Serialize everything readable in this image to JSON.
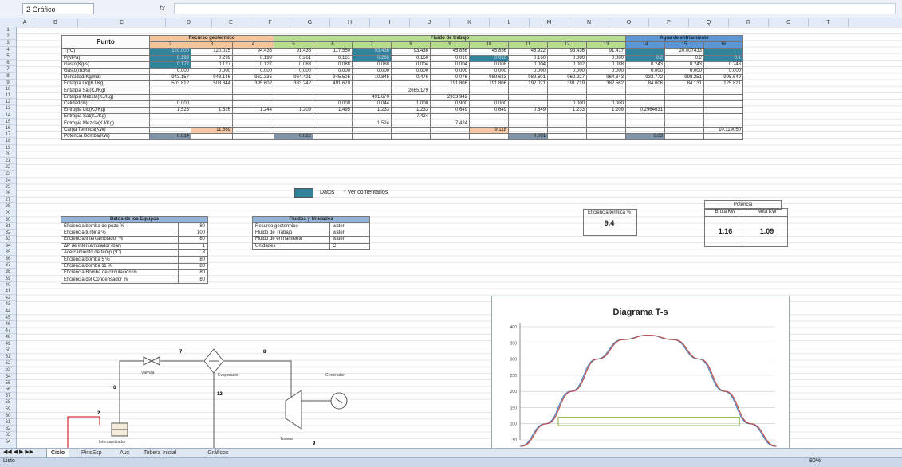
{
  "formula_bar": {
    "name_box": "2 Gráfico",
    "fx": "fx",
    "formula": ""
  },
  "columns": [
    "A",
    "B",
    "C",
    "D",
    "E",
    "F",
    "G",
    "H",
    "I",
    "J",
    "K",
    "L",
    "M",
    "N",
    "O",
    "P",
    "Q",
    "R",
    "S",
    "T"
  ],
  "rows": [
    "1",
    "2",
    "3",
    "4",
    "5",
    "6",
    "7",
    "8",
    "9",
    "10",
    "11",
    "12",
    "13",
    "14",
    "15",
    "16",
    "17",
    "18",
    "19",
    "20",
    "21",
    "22",
    "23",
    "24",
    "25",
    "26",
    "27",
    "28",
    "29",
    "30",
    "31",
    "32",
    "33",
    "34",
    "35",
    "36",
    "37",
    "38",
    "39",
    "40",
    "41",
    "42",
    "43",
    "44",
    "45",
    "46",
    "47",
    "48",
    "49",
    "50",
    "51",
    "52",
    "53",
    "54",
    "55",
    "56",
    "57",
    "58",
    "59",
    "60",
    "61",
    "62",
    "63",
    "64"
  ],
  "main_table": {
    "punto": "Punto",
    "group_headers": {
      "recurso": "Recurso geotermico",
      "fluido": "Fluido de trabajo",
      "agua": "Agua de enfriamiento"
    },
    "points": [
      "2",
      "3",
      "4",
      "5",
      "6",
      "7",
      "8",
      "9",
      "10",
      "11",
      "12",
      "13",
      "14",
      "15",
      "16"
    ],
    "rows": [
      {
        "label": "T(ºC)",
        "cells": [
          "120.000",
          "120.015",
          "94.436",
          "91.436",
          "117.550",
          "93.436",
          "93.436",
          "45.856",
          "45.856",
          "45.922",
          "93.436",
          "91.417",
          "",
          "20.007433",
          ""
        ]
      },
      {
        "label": "P(MPa)",
        "cells": [
          "0.199",
          "0.299",
          "0.199",
          "0.261",
          "0.161",
          "0.286",
          "0.160",
          "0.010",
          "0.010",
          "0.160",
          "0.080",
          "0.080",
          "0.2",
          "0.2",
          "0.1"
        ]
      },
      {
        "label": "Gasto(Kg/s)",
        "cells": [
          "0.177",
          "0.127",
          "0.127",
          "0.088",
          "0.088",
          "0.088",
          "0.004",
          "0.004",
          "0.008",
          "0.004",
          "0.002",
          "0.088",
          "0.243",
          "0.243",
          "0.243"
        ]
      },
      {
        "label": "Gasto(m3/s)",
        "cells": [
          "0.000",
          "0.000",
          "0.000",
          "0.000",
          "0.000",
          "0.000",
          "0.000",
          "0.000",
          "0.000",
          "0.000",
          "0.000",
          "0.000",
          "0.000",
          "0.000",
          "0.000"
        ]
      },
      {
        "label": "Densidad(Kg/m3)",
        "cells": [
          "943.157",
          "943.146",
          "962.335",
          "964.421",
          "945.505",
          "10.845",
          "0.476",
          "0.076",
          "989.623",
          "989.601",
          "962.927",
          "964.343",
          "933.772",
          "998.251",
          "995.649"
        ]
      },
      {
        "label": "Entalpia Liq(KJ/Kg)",
        "cells": [
          "503.812",
          "503.844",
          "395.602",
          "383.242",
          "491.670",
          "",
          "",
          "191.806",
          "191.806",
          "192.021",
          "391.719",
          "382.562",
          "84.006",
          "84.131",
          "125.821"
        ]
      },
      {
        "label": "Entalpia Sat(KJ/Kg)",
        "cells": [
          "",
          "",
          "",
          "",
          "",
          "",
          "2665.179",
          "",
          "",
          "",
          "",
          "",
          "",
          "",
          ""
        ]
      },
      {
        "label": "Entalpia Mezcla(KJ/Kg)",
        "cells": [
          "",
          "",
          "",
          "",
          "",
          "491.670",
          "",
          "2333.942",
          "",
          "",
          "",
          "",
          "",
          "",
          ""
        ]
      },
      {
        "label": "Calidad(%)",
        "cells": [
          "0.000",
          "",
          "",
          "",
          "0.000",
          "0.044",
          "1.000",
          "0.900",
          "0.000",
          "",
          "0.000",
          "0.000",
          "",
          "",
          ""
        ]
      },
      {
        "label": "Entropia Liq(KJ/Kg)",
        "cells": [
          "1.526",
          "1.526",
          "1.244",
          "1.209",
          "1.495",
          "1.233",
          "1.233",
          "0.649",
          "0.649",
          "0.649",
          "1.233",
          "1.209",
          "0.2964631",
          "",
          ""
        ]
      },
      {
        "label": "Entropia Sat(KJ/Kg)",
        "cells": [
          "",
          "",
          "",
          "",
          "",
          "",
          "7.424",
          "",
          "",
          "",
          "",
          "",
          "",
          "",
          ""
        ]
      },
      {
        "label": "Entropia Mezcla(KJ/Kg)",
        "cells": [
          "",
          "",
          "",
          "",
          "",
          "1.524",
          "",
          "7.424",
          "",
          "",
          "",
          "",
          "",
          "",
          ""
        ]
      },
      {
        "label": "Carga Termica(KW)",
        "cells": [
          "",
          "11.569",
          "",
          "",
          "",
          "",
          "",
          "",
          "9.118",
          "",
          "",
          "",
          "",
          "",
          "10.119050"
        ]
      },
      {
        "label": "Potencia Bomba(KW)",
        "cells": [
          "0.014",
          "",
          "",
          "0.022",
          "",
          "",
          "",
          "",
          "",
          "0.001",
          "",
          "",
          "0.03",
          "",
          ""
        ]
      }
    ]
  },
  "legend": {
    "label": "Datos",
    "note": "* Ver comentarios"
  },
  "equipos": {
    "title": "Datos de los Equipos",
    "rows": [
      {
        "label": "Eficiencia bomba de pozo %",
        "value": "80"
      },
      {
        "label": "Eficiencia turbina %",
        "value": "100"
      },
      {
        "label": "Eficiencia intercambiador %",
        "value": "80"
      },
      {
        "label": "ΔP de intercambiador (bar)",
        "value": "1"
      },
      {
        "label": "Acercamiento de temp (ºC)",
        "value": "3"
      },
      {
        "label": "Eficiencia bomba 5 %",
        "value": "80"
      },
      {
        "label": "Eficiencia bomba 11 %",
        "value": "80"
      },
      {
        "label": "Eficiencia Bomba de circulación %",
        "value": "80"
      },
      {
        "label": "Eficiencia del Condensador %",
        "value": "80"
      }
    ]
  },
  "fluidos": {
    "title": "Fluidos y Unidades",
    "rows": [
      {
        "label": "Recurso geotermico",
        "value": "water"
      },
      {
        "label": "Fluido de Trabajo",
        "value": "water"
      },
      {
        "label": "Fluido de enfriamiento",
        "value": "water"
      },
      {
        "label": "Unidades",
        "value": "C"
      }
    ]
  },
  "eficiencia": {
    "label": "Eficiencia termica %",
    "value": "9.4"
  },
  "potencia": {
    "title": "Potencia",
    "bruta_label": "Bruta KW",
    "neta_label": "Neta KW",
    "bruta_value": "1.16",
    "neta_value": "1.09"
  },
  "chart_data": {
    "type": "line",
    "title": "Diagrama T-s",
    "y_ticks": [
      "400",
      "350",
      "300",
      "250",
      "200",
      "150",
      "100",
      "50"
    ],
    "ylim": [
      50,
      400
    ],
    "series": [
      {
        "color": "#4f81bd",
        "x": [
          0,
          1,
          2,
          3,
          4,
          5,
          6,
          7,
          8,
          9,
          10
        ],
        "values": [
          10,
          100,
          200,
          300,
          360,
          374,
          360,
          300,
          200,
          100,
          10
        ]
      },
      {
        "color": "#c0504d",
        "x": [
          0,
          1,
          2,
          3,
          4,
          5,
          6,
          7,
          8,
          9,
          10
        ],
        "values": [
          10,
          100,
          200,
          300,
          360,
          374,
          360,
          300,
          200,
          100,
          10
        ]
      },
      {
        "color": "#9bbb59",
        "x": [
          1.5,
          8.6,
          8.6,
          1.5,
          1.5
        ],
        "values": [
          94,
          94,
          120,
          120,
          94
        ]
      }
    ]
  },
  "diagram": {
    "labels": {
      "valvula": "Válvula",
      "evaporador": "Evaporador",
      "turbina": "Turbina",
      "generador": "Generador",
      "intercambiador": "Intercambiador"
    },
    "numbers": [
      "7",
      "8",
      "6",
      "12",
      "2",
      "9"
    ]
  },
  "sheet_tabs": [
    "Ciclo",
    "PinsEsp",
    "Aux",
    "Tobera Inicial",
    "Gráficos"
  ],
  "active_tab": "Ciclo",
  "status": {
    "left": "Listo",
    "zoom": "80%"
  },
  "colors": {
    "teal": "#31849b",
    "orange": "#f4c49a",
    "green": "#b7dc8e",
    "blue": "#5b97d6"
  }
}
